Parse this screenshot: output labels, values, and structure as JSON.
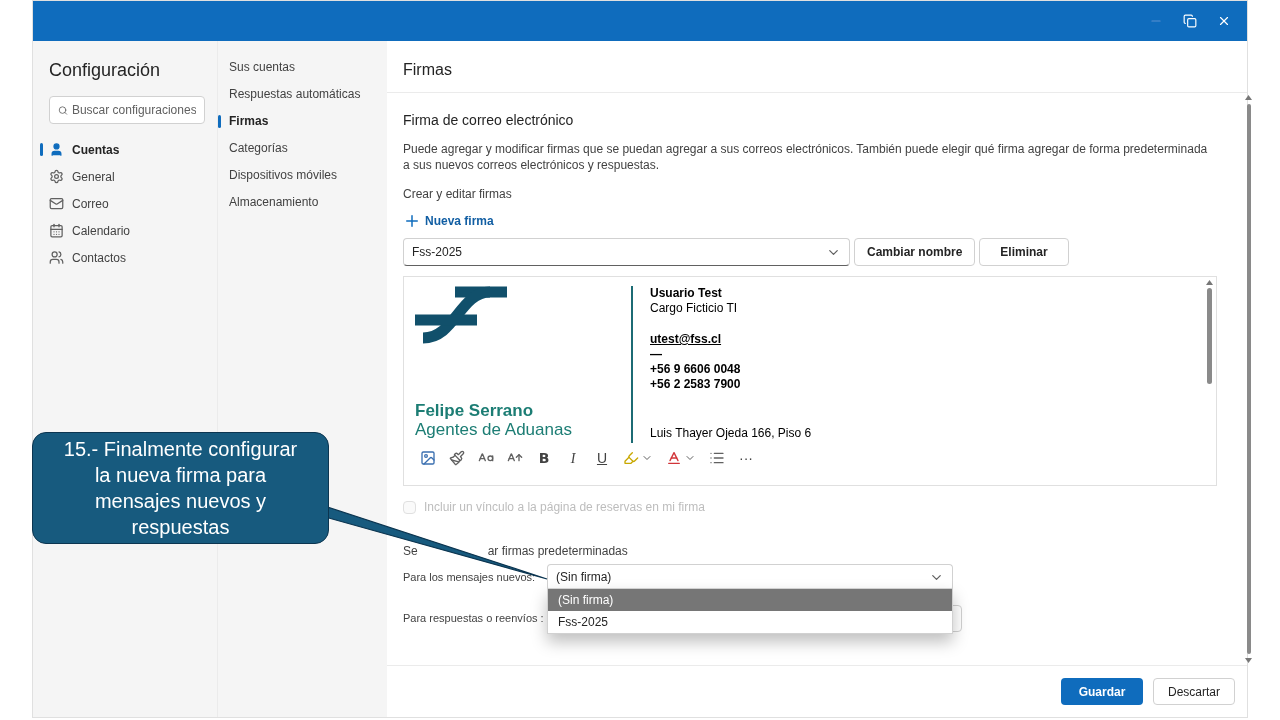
{
  "window": {
    "controls": [
      {
        "kind": "minimize"
      },
      {
        "kind": "restore"
      },
      {
        "kind": "close"
      }
    ]
  },
  "settings": {
    "title": "Configuración",
    "search": {
      "placeholder": "Buscar configuraciones"
    },
    "categories": [
      {
        "label": "Cuentas",
        "selected": true
      },
      {
        "label": "General",
        "selected": false
      },
      {
        "label": "Correo",
        "selected": false
      },
      {
        "label": "Calendario",
        "selected": false
      },
      {
        "label": "Contactos",
        "selected": false
      }
    ]
  },
  "subcategories": [
    {
      "label": "Sus cuentas",
      "selected": false
    },
    {
      "label": "Respuestas automáticas",
      "selected": false
    },
    {
      "label": "Firmas",
      "selected": true
    },
    {
      "label": "Categorías",
      "selected": false
    },
    {
      "label": "Dispositivos móviles",
      "selected": false
    },
    {
      "label": "Almacenamiento",
      "selected": false
    }
  ],
  "panel": {
    "title": "Firmas",
    "section": "Firma de correo electrónico",
    "description": "Puede agregar y modificar firmas que se puedan agregar a sus correos electrónicos. También puede elegir qué firma agregar de forma predeterminada a sus nuevos correos electrónicos y respuestas.",
    "create_label": "Crear y editar firmas",
    "new_button": "Nueva firma",
    "signature_select": "Fss-2025",
    "rename_button": "Cambiar nombre",
    "delete_button": "Eliminar",
    "signature": {
      "company_name": "Felipe Serrano",
      "company_subtitle": "Agentes de Aduanas",
      "name": "Usuario Test",
      "role": "Cargo Ficticio TI",
      "email": "utest@fss.cl",
      "dash": "—",
      "phones": [
        "+56 9 6606 0048",
        "+56 2 2583 7900"
      ],
      "address": "Luis Thayer Ojeda 166, Piso 6"
    },
    "toolbar": [
      {
        "kind": "image"
      },
      {
        "kind": "brush"
      },
      {
        "kind": "font-size"
      },
      {
        "kind": "grow"
      },
      {
        "kind": "bold",
        "label": "B"
      },
      {
        "kind": "italic",
        "label": "I"
      },
      {
        "kind": "underline",
        "label": "U"
      },
      {
        "kind": "highlight"
      },
      {
        "kind": "font-color"
      },
      {
        "kind": "list"
      },
      {
        "kind": "more",
        "label": "···"
      }
    ],
    "booking_checkbox": {
      "label": "Incluir un vínculo a la página de reservas en mi firma",
      "checked": false,
      "disabled": true
    },
    "defaults_heading": {
      "start": "Se",
      "end": "ar firmas predeterminadas"
    },
    "new_messages": {
      "label": "Para los mensajes nuevos:",
      "value": "(Sin firma)",
      "expanded": true,
      "options": [
        {
          "label": "(Sin firma)",
          "selected": true
        },
        {
          "label": "Fss-2025",
          "selected": false
        }
      ]
    },
    "replies": {
      "label": "Para respuestas o reenvíos :"
    },
    "save_button": "Guardar",
    "discard_button": "Descartar"
  },
  "callout": {
    "text": "15.- Finalmente configurar la nueva firma para mensajes nuevos y respuestas"
  }
}
